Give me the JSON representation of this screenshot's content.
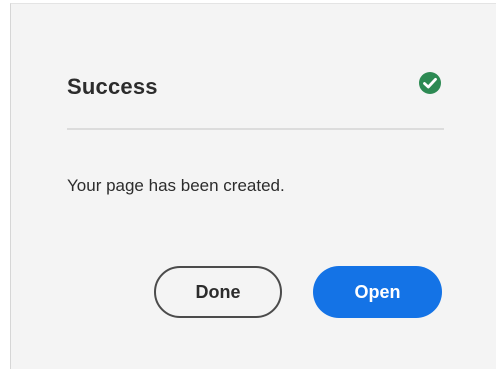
{
  "dialog": {
    "title": "Success",
    "status_icon": "check-circle-icon",
    "message": "Your page has been created.",
    "buttons": {
      "done_label": "Done",
      "open_label": "Open"
    },
    "colors": {
      "success_green": "#2d8a53",
      "primary_blue": "#1473e6",
      "background": "#f4f4f4"
    }
  }
}
